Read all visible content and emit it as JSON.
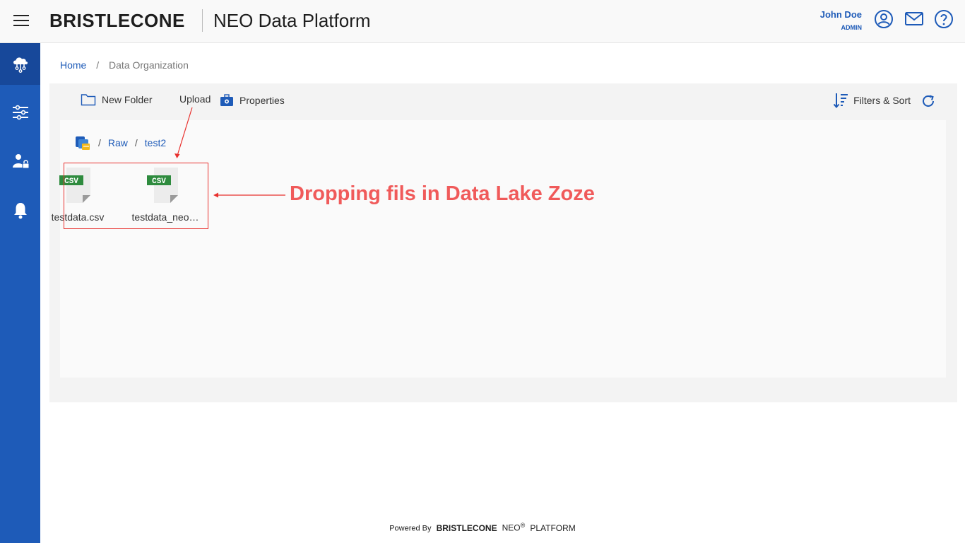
{
  "header": {
    "logo_text": "BRISTLECONE",
    "app_title": "NEO Data Platform",
    "user_name": "John Doe",
    "user_role": "ADMIN"
  },
  "breadcrumb": {
    "home": "Home",
    "separator": "/",
    "current": "Data Organization"
  },
  "toolbar": {
    "new_folder": "New Folder",
    "upload": "Upload",
    "properties": "Properties",
    "filters_sort": "Filters & Sort"
  },
  "path": {
    "separator": "/",
    "items": [
      "Raw",
      "test2"
    ]
  },
  "files": [
    {
      "name": "testdata.csv",
      "badge": "CSV"
    },
    {
      "name": "testdata_neo…",
      "badge": "CSV"
    }
  ],
  "annotation": {
    "text": "Dropping fils in Data Lake Zoze",
    "color": "#f05a5a"
  },
  "footer": {
    "powered_by": "Powered By",
    "brand": "BRISTLECONE",
    "neo": "NEO",
    "reg": "®",
    "platform": "PLATFORM"
  },
  "colors": {
    "brand_blue": "#1e5bb8",
    "sidebar": "#1e5bb8",
    "csv_green": "#2e8b3e",
    "highlight_red": "#e8312e"
  },
  "icons": {
    "sidebar": [
      "cloud-network-icon",
      "sliders-icon",
      "user-lock-icon",
      "bell-icon"
    ],
    "header": [
      "user-circle-icon",
      "mail-icon",
      "help-icon"
    ]
  }
}
